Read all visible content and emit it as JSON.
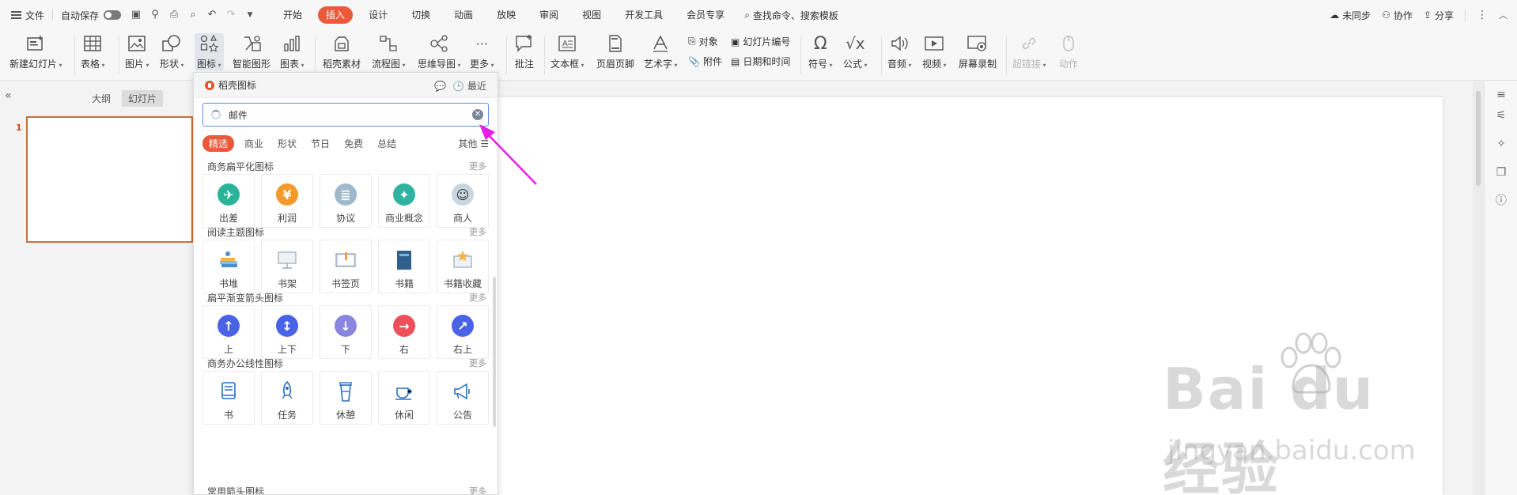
{
  "menubar": {
    "file": "文件",
    "autosave": "自动保存",
    "tabs": [
      "开始",
      "插入",
      "设计",
      "切换",
      "动画",
      "放映",
      "审阅",
      "视图",
      "开发工具",
      "会员专享"
    ],
    "active_tab": "插入",
    "search_placeholder": "查找命令、搜索模板",
    "sync": "未同步",
    "collab": "协作",
    "share": "分享"
  },
  "ribbon": {
    "new_slide": "新建幻灯片",
    "table": "表格",
    "picture": "图片",
    "shape": "形状",
    "icon": "图标",
    "smart_art": "智能图形",
    "chart": "图表",
    "docer_material": "稻壳素材",
    "flowchart": "流程图",
    "mindmap": "思维导图",
    "more": "更多",
    "comment": "批注",
    "textbox": "文本框",
    "header_footer": "页眉页脚",
    "wordart": "艺术字",
    "object": "对象",
    "attachment": "附件",
    "slide_number": "幻灯片编号",
    "date_time": "日期和时间",
    "symbol": "符号",
    "formula": "公式",
    "audio": "音频",
    "video": "视频",
    "screen_record": "屏幕录制",
    "hyperlink": "超链接",
    "action": "动作"
  },
  "leftpanel": {
    "outline_tab": "大纲",
    "slides_tab": "幻灯片",
    "slide_number": "1"
  },
  "panel": {
    "title": "稻壳图标",
    "recent": "最近",
    "search_value": "邮件",
    "categories": [
      "精选",
      "商业",
      "形状",
      "节日",
      "免费",
      "总结"
    ],
    "other": "其他",
    "more_label": "更多",
    "sections": [
      {
        "title": "商务扁平化图标",
        "items": [
          "出差",
          "利润",
          "协议",
          "商业概念",
          "商人"
        ]
      },
      {
        "title": "阅读主题图标",
        "items": [
          "书堆",
          "书架",
          "书签页",
          "书籍",
          "书籍收藏"
        ]
      },
      {
        "title": "扁平渐变箭头图标",
        "items": [
          "上",
          "上下",
          "下",
          "右",
          "右上"
        ]
      },
      {
        "title": "商务办公线性图标",
        "items": [
          "书",
          "任务",
          "休憩",
          "休闲",
          "公告"
        ]
      },
      {
        "title": "常用箭头图标",
        "items": []
      }
    ]
  },
  "watermark": {
    "logo": "Bai du 经验",
    "url": "jingyan.baidu.com"
  },
  "colors": {
    "accent": "#ea5a3a",
    "search_border": "#5b8ff0",
    "arrow": "#e91ee6"
  }
}
